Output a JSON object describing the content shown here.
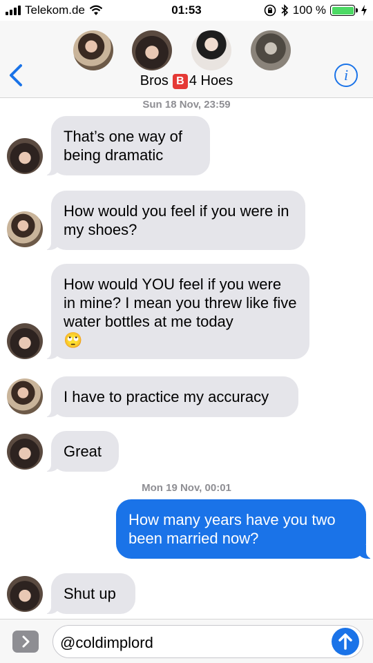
{
  "status_bar": {
    "carrier": "Telekom.de",
    "time": "01:53",
    "battery": "100 %",
    "battery_level": 1.0
  },
  "header": {
    "title_left": "Bros",
    "title_emoji": "B",
    "title_right": "4 Hoes",
    "info_label": "i"
  },
  "messages": [
    {
      "type": "timestamp",
      "text": "Sun 18 Nov, 23:59"
    },
    {
      "type": "in",
      "text": "That’s one way of being dramatic"
    },
    {
      "type": "in",
      "text": "How would you feel if you were in my shoes?"
    },
    {
      "type": "in",
      "text": "How would YOU feel if you were in mine? I mean you threw like five water bottles at me today",
      "emoji": "🙄"
    },
    {
      "type": "in",
      "text": "I have to practice my accuracy"
    },
    {
      "type": "in",
      "text": "Great"
    },
    {
      "type": "timestamp",
      "text": "Mon 19 Nov, 00:01"
    },
    {
      "type": "out",
      "text": "How many years have you two been married now?"
    },
    {
      "type": "in",
      "text": "Shut up"
    }
  ],
  "composer": {
    "value": "@coldimplord"
  },
  "colors": {
    "accent": "#1a73e8",
    "incoming_bubble": "#e5e5ea",
    "timestamp": "#8e8e93"
  },
  "icons": [
    "signal-icon",
    "wifi-icon",
    "lock-rotation-icon",
    "bluetooth-icon",
    "battery-icon",
    "charging-icon",
    "back-chevron-icon",
    "info-icon",
    "expand-icon",
    "send-arrow-icon"
  ]
}
